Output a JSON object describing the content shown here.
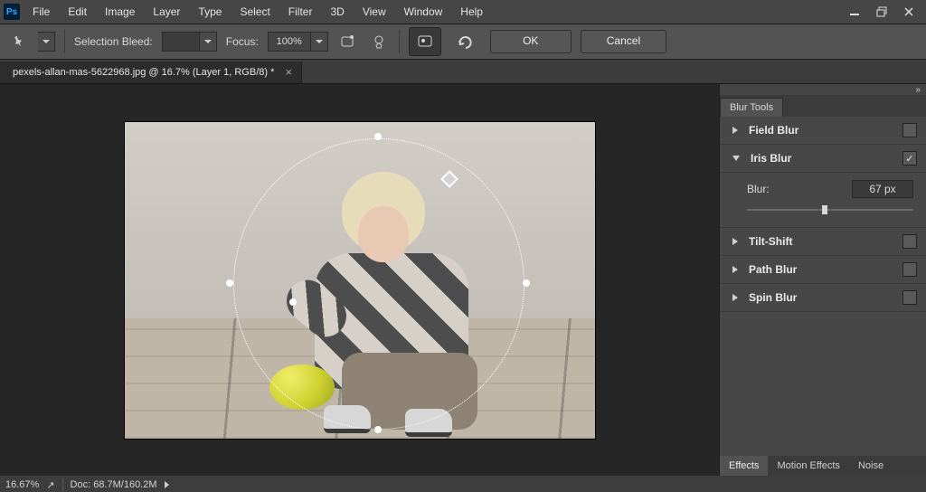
{
  "menubar": {
    "items": [
      "File",
      "Edit",
      "Image",
      "Layer",
      "Type",
      "Select",
      "Filter",
      "3D",
      "View",
      "Window",
      "Help"
    ]
  },
  "window_controls": {
    "minimize": "_",
    "maximize": "❐",
    "close": "✕"
  },
  "optbar": {
    "selection_bleed_label": "Selection Bleed:",
    "focus_label": "Focus:",
    "focus_value": "100%",
    "ok_label": "OK",
    "cancel_label": "Cancel"
  },
  "doc_tab": {
    "title": "pexels-allan-mas-5622968.jpg @ 16.7% (Layer 1, RGB/8) *",
    "close": "×"
  },
  "blur_panel": {
    "tab": "Blur Tools",
    "items": [
      {
        "label": "Field Blur",
        "expanded": false,
        "checked": false
      },
      {
        "label": "Iris Blur",
        "expanded": true,
        "checked": true,
        "slider": {
          "label": "Blur:",
          "value": "67 px",
          "pct": 45
        }
      },
      {
        "label": "Tilt-Shift",
        "expanded": false,
        "checked": false
      },
      {
        "label": "Path Blur",
        "expanded": false,
        "checked": false
      },
      {
        "label": "Spin Blur",
        "expanded": false,
        "checked": false
      }
    ],
    "bottom_tabs": [
      "Effects",
      "Motion Effects",
      "Noise"
    ]
  },
  "statusbar": {
    "zoom": "16.67%",
    "doc": "Doc: 68.7M/160.2M"
  },
  "icons": {
    "pin": "📌",
    "gear": "⚙",
    "ribbon": "🏷",
    "reset": "↺",
    "share": "↗",
    "flyout": "»"
  }
}
